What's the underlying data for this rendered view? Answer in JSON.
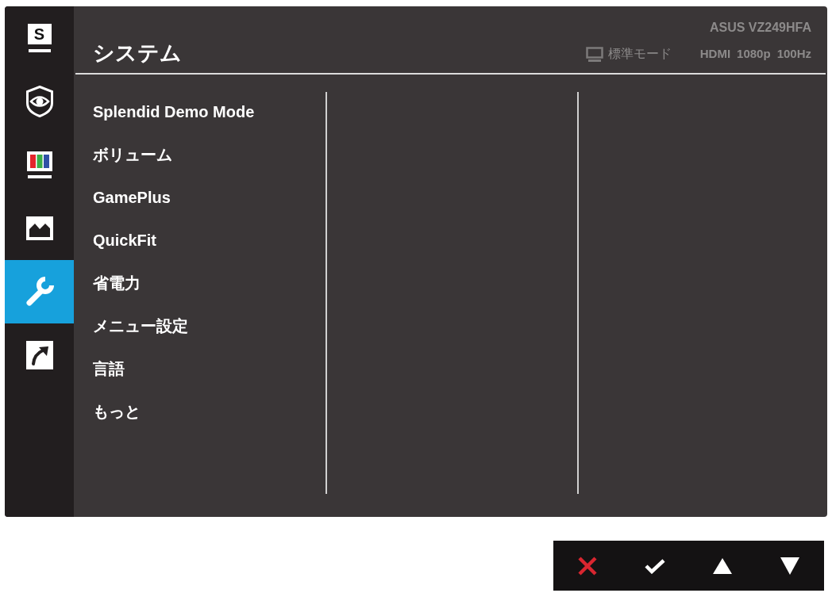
{
  "sidebar": {
    "items": [
      {
        "kind": "splendid",
        "glyph": "S",
        "selected": false
      },
      {
        "kind": "eye_care",
        "selected": false
      },
      {
        "kind": "color",
        "selected": false
      },
      {
        "kind": "image",
        "selected": false
      },
      {
        "kind": "system",
        "selected": true
      },
      {
        "kind": "shortcut",
        "selected": false
      }
    ]
  },
  "header": {
    "title": "システム",
    "model": "ASUS VZ249HFA",
    "status": {
      "mode": "標準モード",
      "input": "HDMI",
      "resolution": "1080p",
      "refresh_rate": "100Hz"
    }
  },
  "menu": {
    "items": [
      {
        "label": "Splendid Demo Mode",
        "selected": false
      },
      {
        "label": "ボリューム",
        "selected": false
      },
      {
        "label": "GamePlus",
        "selected": false
      },
      {
        "label": "QuickFit",
        "selected": false
      },
      {
        "label": "省電力",
        "selected": false
      },
      {
        "label": "メニュー設定",
        "selected": false
      },
      {
        "label": "言語",
        "selected": false
      },
      {
        "label": "もっと",
        "selected": false
      }
    ]
  },
  "buttons": [
    {
      "kind": "close"
    },
    {
      "kind": "confirm"
    },
    {
      "kind": "up"
    },
    {
      "kind": "down"
    }
  ]
}
